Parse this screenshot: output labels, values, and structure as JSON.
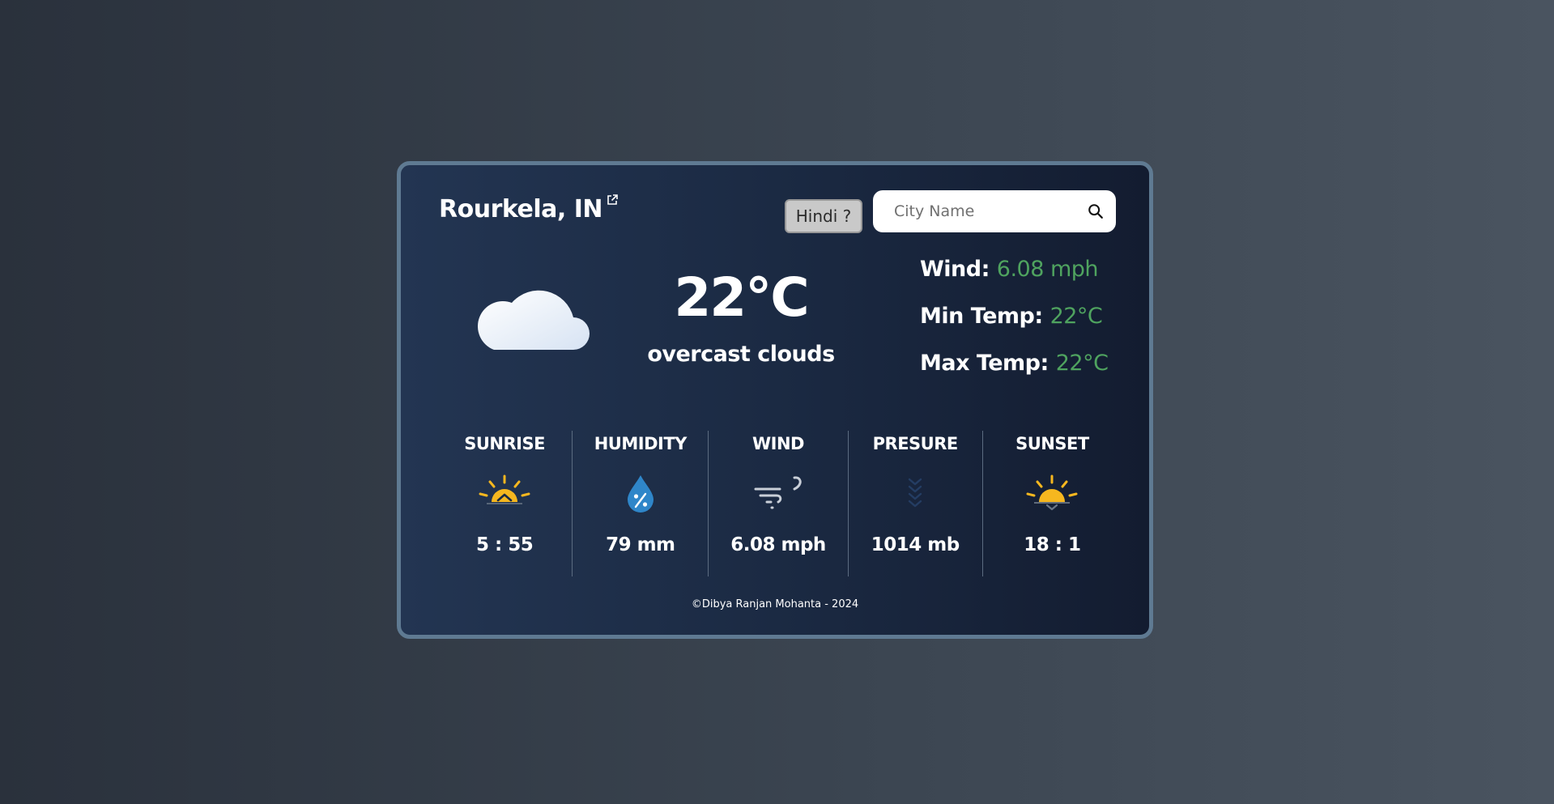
{
  "location": {
    "city": "Rourkela, IN"
  },
  "language_button": "Hindi ?",
  "search": {
    "placeholder": "City Name",
    "value": ""
  },
  "current": {
    "temperature": "22°C",
    "condition": "overcast clouds",
    "icon": "cloud-icon"
  },
  "stats": {
    "wind_label": "Wind:",
    "wind_value": "6.08 mph",
    "min_label": "Min Temp:",
    "min_value": "22°C",
    "max_label": "Max Temp:",
    "max_value": "22°C"
  },
  "metrics": [
    {
      "title": "SUNRISE",
      "value": "5 : 55",
      "icon": "sunrise-icon"
    },
    {
      "title": "HUMIDITY",
      "value": "79 mm",
      "icon": "humidity-drop-icon"
    },
    {
      "title": "WIND",
      "value": "6.08 mph",
      "icon": "wind-icon"
    },
    {
      "title": "PRESURE",
      "value": "1014 mb",
      "icon": "pressure-icon"
    },
    {
      "title": "SUNSET",
      "value": "18 : 1",
      "icon": "sunset-icon"
    }
  ],
  "footer": "©Dibya Ranjan Mohanta - 2024",
  "colors": {
    "accent_green": "#4fa35f",
    "card_border": "#5f7a92",
    "sun_yellow": "#f6b71f",
    "drop_blue": "#2f86c9"
  }
}
